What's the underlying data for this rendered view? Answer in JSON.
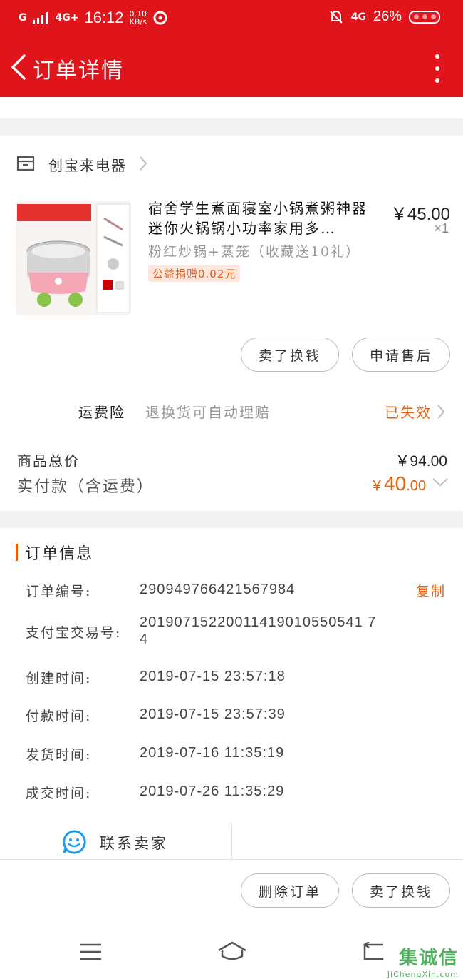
{
  "status_bar": {
    "signal_1": "G",
    "signal_2": "4G+",
    "time": "16:12",
    "net_speed": "0.10",
    "net_unit": "KB/s",
    "net_right": "4G",
    "battery": "26%"
  },
  "nav": {
    "title": "订单详情",
    "back_icon": "chevron-left-icon",
    "more_icon": "vertical-dots-icon"
  },
  "shop": {
    "name": "创宝来电器",
    "icon": "store-icon"
  },
  "product": {
    "title": "宿舍学生煮面寝室小锅煮粥神器迷你火锅锅小功率家用多…",
    "price": "￥45.00",
    "qty": "×1",
    "sku": "粉红炒锅+蒸笼（收藏送10礼）",
    "charity": "公益捐赠0.02元"
  },
  "actions_top": {
    "sell": "卖了换钱",
    "after_sale": "申请售后"
  },
  "insurance": {
    "label": "运费险",
    "desc": "退换货可自动理赔",
    "status": "已失效"
  },
  "totals": {
    "goods_label": "商品总价",
    "goods_value": "￥94.00",
    "paid_label": "实付款（含运费）",
    "paid_currency": "￥",
    "paid_int": "40",
    "paid_dec": ".00"
  },
  "order_info": {
    "heading": "订单信息",
    "copy_label": "复制",
    "rows": [
      {
        "key": "订单编号:",
        "value": "290949766421567984"
      },
      {
        "key": "支付宝交易号:",
        "value": "20190715220011419010550541 74"
      },
      {
        "key": "创建时间:",
        "value": "2019-07-15 23:57:18"
      },
      {
        "key": "付款时间:",
        "value": "2019-07-15 23:57:39"
      },
      {
        "key": "发货时间:",
        "value": "2019-07-16 11:35:19"
      },
      {
        "key": "成交时间:",
        "value": "2019-07-26 11:35:29"
      }
    ]
  },
  "contact": {
    "label": "联系卖家",
    "icon": "chat-bubble-icon"
  },
  "actions_bottom": {
    "delete": "删除订单",
    "sell": "卖了换钱"
  },
  "watermark": {
    "text": "集诚信",
    "sub": "JiChengXin.com"
  },
  "colors": {
    "header_red": "#e0141b",
    "accent_orange": "#e8600e"
  }
}
